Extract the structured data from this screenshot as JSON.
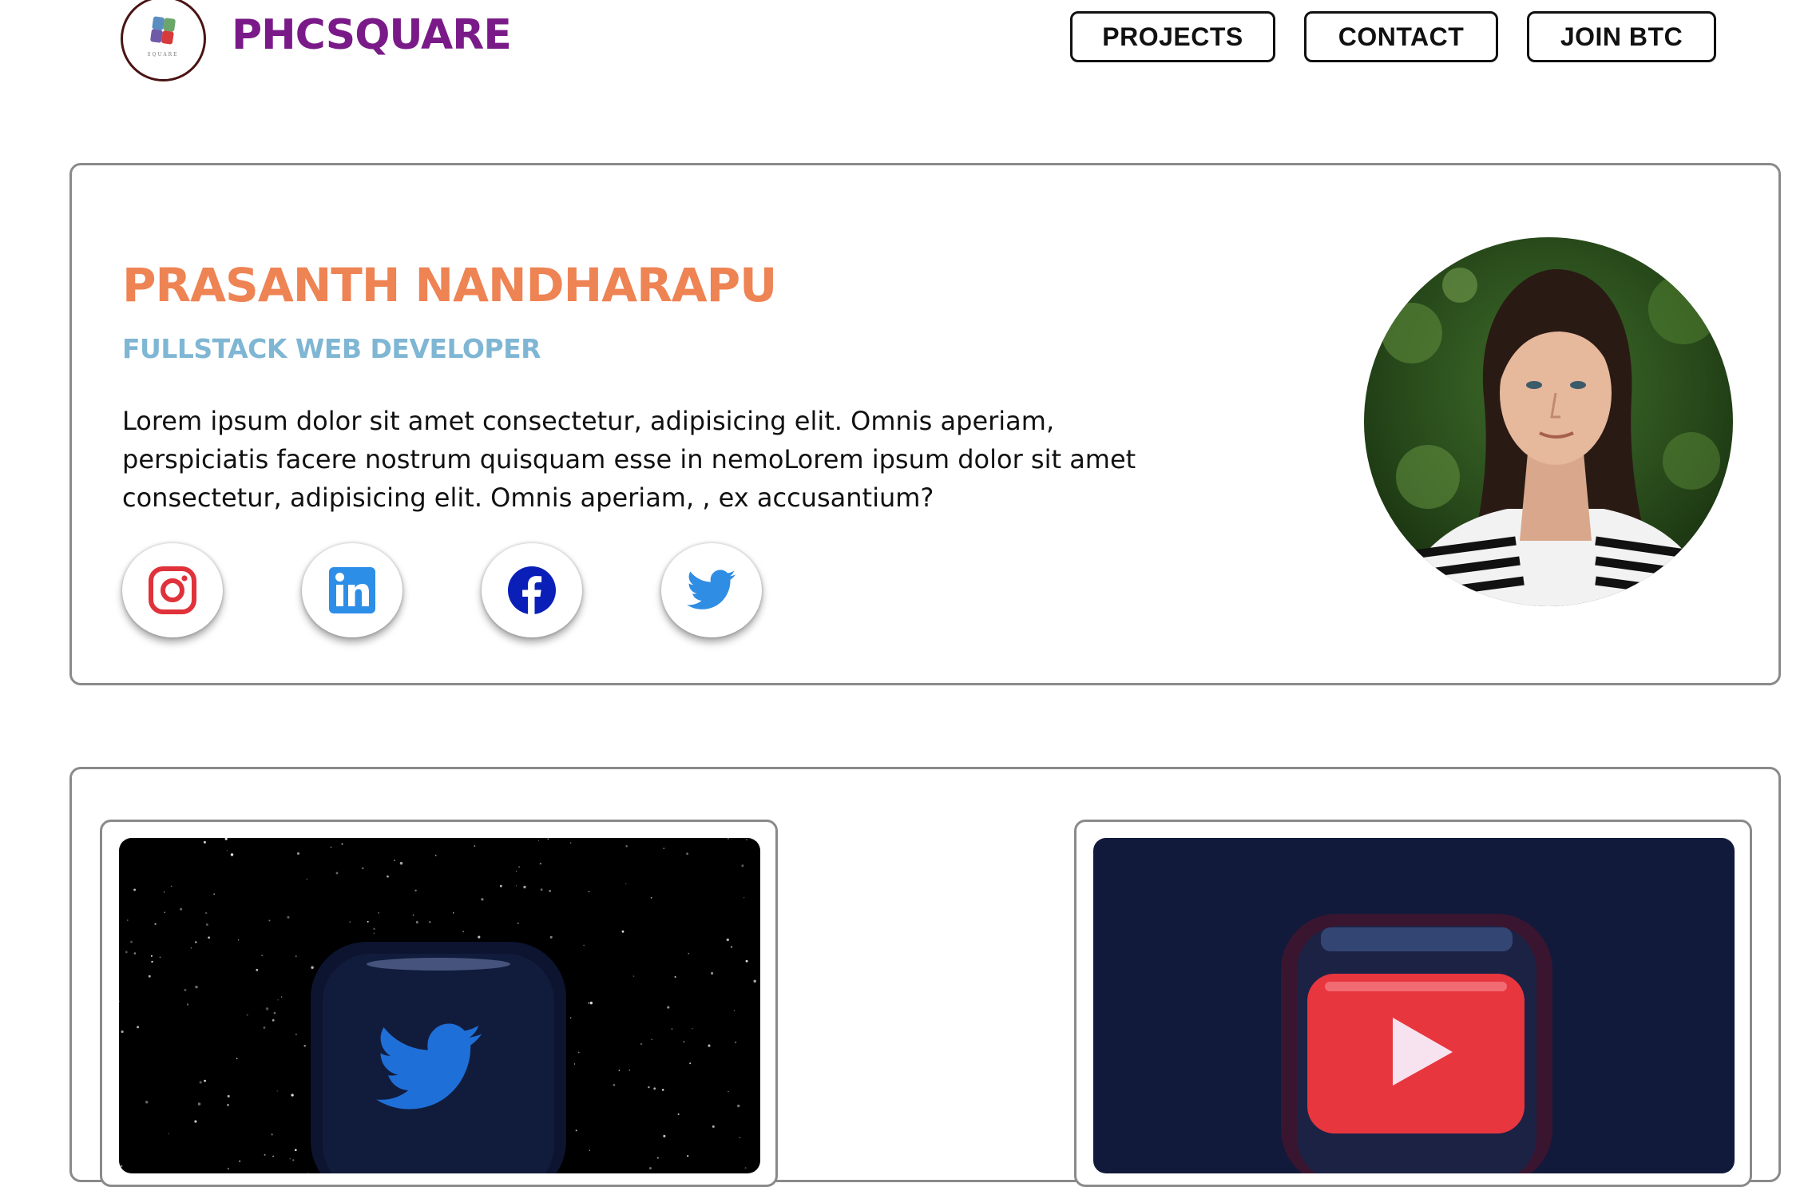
{
  "header": {
    "brand": "PHCSQUARE",
    "logo_text": "SQUARE",
    "nav": {
      "projects": "PROJECTS",
      "contact": "CONTACT",
      "join": "JOIN BTC"
    }
  },
  "hero": {
    "name": "PRASANTH NANDHARAPU",
    "role": "FULLSTACK WEB DEVELOPER",
    "bio": "Lorem ipsum dolor sit amet consectetur, adipisicing elit. Omnis aperiam, perspiciatis facere nostrum quisquam esse in nemoLorem ipsum dolor sit amet consectetur, adipisicing elit. Omnis aperiam, , ex accusantium?",
    "socials": [
      "instagram-icon",
      "linkedin-icon",
      "facebook-icon",
      "twitter-icon"
    ]
  },
  "colors": {
    "brand": "#7a1a88",
    "name": "#ee8354",
    "role": "#7fb6d4",
    "instagram": "#e1306c",
    "linkedin": "#2d8ee8",
    "facebook": "#0a1fb8",
    "twitter": "#2f8de4"
  },
  "projects": [
    {
      "thumbnail": "twitter-3d-icon"
    },
    {
      "thumbnail": "youtube-3d-icon"
    }
  ]
}
